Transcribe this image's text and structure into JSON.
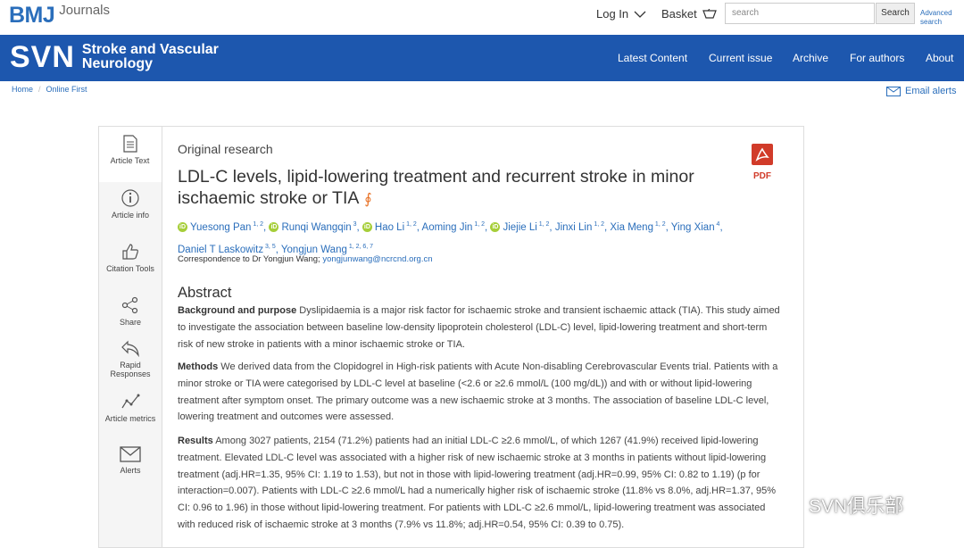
{
  "topbar": {
    "logo_main": "BMJ",
    "logo_sub": "Journals",
    "login_label": "Log In",
    "basket_label": "Basket",
    "search_placeholder": "search",
    "search_button": "Search",
    "advanced_search": "Advanced search"
  },
  "header": {
    "brand": "SVN",
    "brand_sub": "Stroke and Vascular Neurology",
    "nav": [
      "Latest Content",
      "Current issue",
      "Archive",
      "For authors",
      "About"
    ],
    "background_color": "#1d57ae"
  },
  "breadcrumb": [
    "Home",
    "Online First"
  ],
  "email_alerts": "Email alerts",
  "rail": [
    {
      "label": "Article Text",
      "icon": "document-icon"
    },
    {
      "label": "Article info",
      "icon": "info-icon"
    },
    {
      "label": "Citation Tools",
      "icon": "thumbs-up-icon"
    },
    {
      "label": "Share",
      "icon": "share-icon"
    },
    {
      "label": "Rapid Responses",
      "icon": "reply-icon"
    },
    {
      "label": "Article metrics",
      "icon": "metrics-icon"
    },
    {
      "label": "Alerts",
      "icon": "envelope-icon"
    }
  ],
  "article": {
    "type": "Original research",
    "title": "LDL-C levels, lipid-lowering treatment and recurrent stroke in minor ischaemic stroke or TIA",
    "pdf_label": "PDF",
    "authors": [
      {
        "name": "Yuesong Pan",
        "aff": "1, 2",
        "orcid": true
      },
      {
        "name": "Runqi Wangqin",
        "aff": "3",
        "orcid": true
      },
      {
        "name": "Hao Li",
        "aff": "1, 2",
        "orcid": true
      },
      {
        "name": "Aoming Jin",
        "aff": "1, 2",
        "orcid": false
      },
      {
        "name": "Jiejie Li",
        "aff": "1, 2",
        "orcid": true
      },
      {
        "name": "Jinxi Lin",
        "aff": "1, 2",
        "orcid": false
      },
      {
        "name": "Xia Meng",
        "aff": "1, 2",
        "orcid": false
      },
      {
        "name": "Ying Xian",
        "aff": "4",
        "orcid": false
      },
      {
        "name": "Daniel T Laskowitz",
        "aff": "3, 5",
        "orcid": false
      },
      {
        "name": "Yongjun Wang",
        "aff": "1, 2, 6, 7",
        "orcid": false
      }
    ],
    "correspondence_label": "Correspondence to Dr Yongjun Wang;",
    "correspondence_email": "yongjunwang@ncrcnd.org.cn"
  },
  "abstract": {
    "heading": "Abstract",
    "background_label": "Background and purpose",
    "background_text": " Dyslipidaemia is a major risk factor for ischaemic stroke and transient ischaemic attack (TIA). This study aimed to investigate the association between baseline low-density lipoprotein cholesterol (LDL-C) level, lipid-lowering treatment and short-term risk of new stroke in patients with a minor ischaemic stroke or TIA.",
    "methods_label": "Methods",
    "methods_text": " We derived data from the Clopidogrel in High-risk patients with Acute Non-disabling Cerebrovascular Events trial. Patients with a minor stroke or TIA were categorised by LDL-C level at baseline (<2.6 or ≥2.6 mmol/L (100 mg/dL)) and with or without lipid-lowering treatment after symptom onset. The primary outcome was a new ischaemic stroke at 3 months. The association of baseline LDL-C level, lowering treatment and outcomes were assessed.",
    "results_label": "Results",
    "results_text": " Among 3027 patients, 2154 (71.2%) patients had an initial LDL-C ≥2.6 mmol/L, of which 1267 (41.9%) received lipid-lowering treatment. Elevated LDL-C level was associated with a higher risk of new ischaemic stroke at 3 months in patients without lipid-lowering treatment (adj.HR=1.35, 95% CI: 1.19 to 1.53), but not in those with lipid-lowering treatment (adj.HR=0.99, 95% CI: 0.82 to 1.19) (p for interaction=0.007). Patients with LDL-C ≥2.6 mmol/L had a numerically higher risk of ischaemic stroke (11.8% vs 8.0%, adj.HR=1.37, 95% CI: 0.96 to 1.96) in those without lipid-lowering treatment. For patients with LDL-C ≥2.6 mmol/L, lipid-lowering treatment was associated with reduced risk of ischaemic stroke at 3 months (7.9% vs 11.8%; adj.HR=0.54, 95% CI: 0.39 to 0.75)."
  },
  "watermark": "SVN俱乐部"
}
